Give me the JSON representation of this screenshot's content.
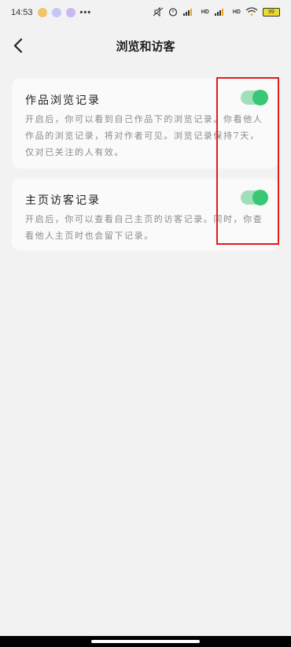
{
  "status_bar": {
    "time": "14:53",
    "dots": "•••",
    "right_labels": {
      "hd1": "HD",
      "hd2": "HD",
      "battery": "99"
    }
  },
  "nav": {
    "title": "浏览和访客"
  },
  "cards": [
    {
      "title": "作品浏览记录",
      "description": "开启后，你可以看到自己作品下的浏览记录。你看他人作品的浏览记录，将对作者可见。浏览记录保持7天，仅对已关注的人有效。",
      "toggle_on": true
    },
    {
      "title": "主页访客记录",
      "description": "开启后，你可以查看自己主页的访客记录。同时，你查看他人主页时也会留下记录。",
      "toggle_on": true
    }
  ],
  "colors": {
    "toggle_track": "#9fe0bb",
    "toggle_knob": "#38c774",
    "highlight": "#e21b1b",
    "background": "#f2f2f2"
  }
}
